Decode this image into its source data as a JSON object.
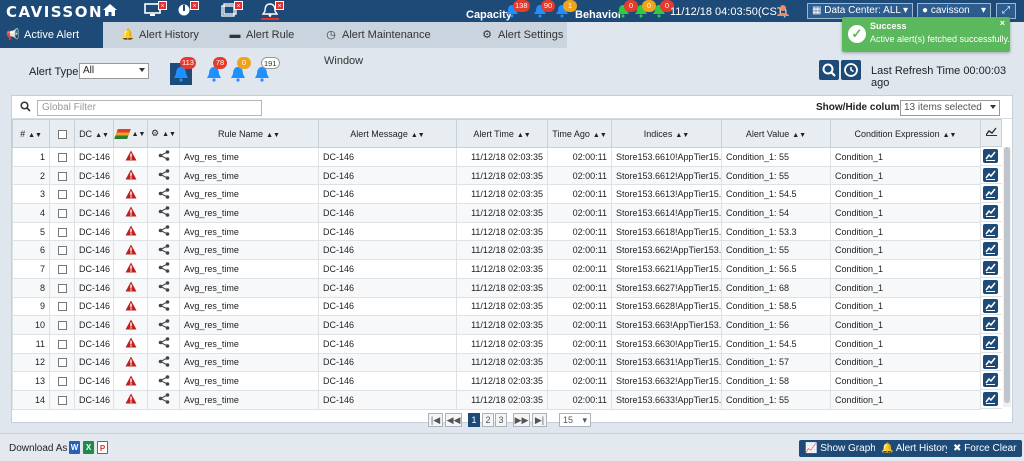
{
  "header": {
    "logo": "CAVISSON",
    "capacity_label": "Capacity",
    "capacity_counts": [
      "138",
      "90",
      "1"
    ],
    "behavior_label": "Behavior",
    "behavior_counts": [
      "0",
      "0",
      "0"
    ],
    "datetime": "11/12/18 04:03:50(CST)",
    "datacenter": "Data Center: ALL",
    "user": "cavisson"
  },
  "tabs": [
    {
      "label": "Active Alert",
      "icon": "alert-icon",
      "active": true
    },
    {
      "label": "Alert History",
      "icon": "bell-icon",
      "active": false
    },
    {
      "label": "Alert Rule",
      "icon": "rule-icon",
      "active": false
    },
    {
      "label": "Alert Maintenance Window",
      "icon": "clock-icon",
      "active": false
    },
    {
      "label": "Alert Settings",
      "icon": "gear-icon",
      "active": false
    }
  ],
  "toolbar": {
    "alert_type_label": "Alert Type",
    "alert_type_value": "All",
    "counters": [
      {
        "value": "113",
        "color": "#e53b2c"
      },
      {
        "value": "78",
        "color": "#e53b2c"
      },
      {
        "value": "0",
        "color": "#f0a21d"
      },
      {
        "value": "191",
        "color": "#ffffff"
      }
    ],
    "refresh_text": "Last Refresh Time 00:00:03 ago"
  },
  "table": {
    "global_filter_placeholder": "Global Filter",
    "show_hide_label": "Show/Hide columns",
    "show_hide_value": "13 items selected",
    "columns": [
      "#",
      "",
      "DC",
      "",
      "",
      "Rule Name",
      "Alert Message",
      "Alert Time",
      "Time Ago",
      "Indices",
      "Alert Value",
      "Condition Expression"
    ],
    "rows": [
      {
        "n": "1",
        "dc": "DC-146",
        "rule": "Avg_res_time",
        "msg": "DC-146",
        "time": "11/12/18 02:03:35",
        "ago": "02:00:11",
        "idx": "Store153.6610!AppTier15...",
        "val": "Condition_1: 55",
        "cond": "Condition_1"
      },
      {
        "n": "2",
        "dc": "DC-146",
        "rule": "Avg_res_time",
        "msg": "DC-146",
        "time": "11/12/18 02:03:35",
        "ago": "02:00:11",
        "idx": "Store153.6612!AppTier15...",
        "val": "Condition_1: 55",
        "cond": "Condition_1"
      },
      {
        "n": "3",
        "dc": "DC-146",
        "rule": "Avg_res_time",
        "msg": "DC-146",
        "time": "11/12/18 02:03:35",
        "ago": "02:00:11",
        "idx": "Store153.6613!AppTier15...",
        "val": "Condition_1: 54.5",
        "cond": "Condition_1"
      },
      {
        "n": "4",
        "dc": "DC-146",
        "rule": "Avg_res_time",
        "msg": "DC-146",
        "time": "11/12/18 02:03:35",
        "ago": "02:00:11",
        "idx": "Store153.6614!AppTier15...",
        "val": "Condition_1: 54",
        "cond": "Condition_1"
      },
      {
        "n": "5",
        "dc": "DC-146",
        "rule": "Avg_res_time",
        "msg": "DC-146",
        "time": "11/12/18 02:03:35",
        "ago": "02:00:11",
        "idx": "Store153.6618!AppTier15...",
        "val": "Condition_1: 53.3",
        "cond": "Condition_1"
      },
      {
        "n": "6",
        "dc": "DC-146",
        "rule": "Avg_res_time",
        "msg": "DC-146",
        "time": "11/12/18 02:03:35",
        "ago": "02:00:11",
        "idx": "Store153.662!AppTier153...",
        "val": "Condition_1: 55",
        "cond": "Condition_1"
      },
      {
        "n": "7",
        "dc": "DC-146",
        "rule": "Avg_res_time",
        "msg": "DC-146",
        "time": "11/12/18 02:03:35",
        "ago": "02:00:11",
        "idx": "Store153.6621!AppTier15...",
        "val": "Condition_1: 56.5",
        "cond": "Condition_1"
      },
      {
        "n": "8",
        "dc": "DC-146",
        "rule": "Avg_res_time",
        "msg": "DC-146",
        "time": "11/12/18 02:03:35",
        "ago": "02:00:11",
        "idx": "Store153.6627!AppTier15...",
        "val": "Condition_1: 68",
        "cond": "Condition_1"
      },
      {
        "n": "9",
        "dc": "DC-146",
        "rule": "Avg_res_time",
        "msg": "DC-146",
        "time": "11/12/18 02:03:35",
        "ago": "02:00:11",
        "idx": "Store153.6628!AppTier15...",
        "val": "Condition_1: 58.5",
        "cond": "Condition_1"
      },
      {
        "n": "10",
        "dc": "DC-146",
        "rule": "Avg_res_time",
        "msg": "DC-146",
        "time": "11/12/18 02:03:35",
        "ago": "02:00:11",
        "idx": "Store153.663!AppTier153...",
        "val": "Condition_1: 56",
        "cond": "Condition_1"
      },
      {
        "n": "11",
        "dc": "DC-146",
        "rule": "Avg_res_time",
        "msg": "DC-146",
        "time": "11/12/18 02:03:35",
        "ago": "02:00:11",
        "idx": "Store153.6630!AppTier15...",
        "val": "Condition_1: 54.5",
        "cond": "Condition_1"
      },
      {
        "n": "12",
        "dc": "DC-146",
        "rule": "Avg_res_time",
        "msg": "DC-146",
        "time": "11/12/18 02:03:35",
        "ago": "02:00:11",
        "idx": "Store153.6631!AppTier15...",
        "val": "Condition_1: 57",
        "cond": "Condition_1"
      },
      {
        "n": "13",
        "dc": "DC-146",
        "rule": "Avg_res_time",
        "msg": "DC-146",
        "time": "11/12/18 02:03:35",
        "ago": "02:00:11",
        "idx": "Store153.6632!AppTier15...",
        "val": "Condition_1: 58",
        "cond": "Condition_1"
      },
      {
        "n": "14",
        "dc": "DC-146",
        "rule": "Avg_res_time",
        "msg": "DC-146",
        "time": "11/12/18 02:03:35",
        "ago": "02:00:11",
        "idx": "Store153.6633!AppTier15...",
        "val": "Condition_1: 55",
        "cond": "Condition_1"
      }
    ]
  },
  "pager": {
    "pages": [
      "1",
      "2",
      "3"
    ],
    "current": "1",
    "page_size": "15"
  },
  "footer": {
    "download_label": "Download As :",
    "show_graph": "Show Graph",
    "alert_history": "Alert History",
    "force_clear": "Force Clear"
  },
  "toast": {
    "title": "Success",
    "message": "Active alert(s) fetched successfully."
  }
}
